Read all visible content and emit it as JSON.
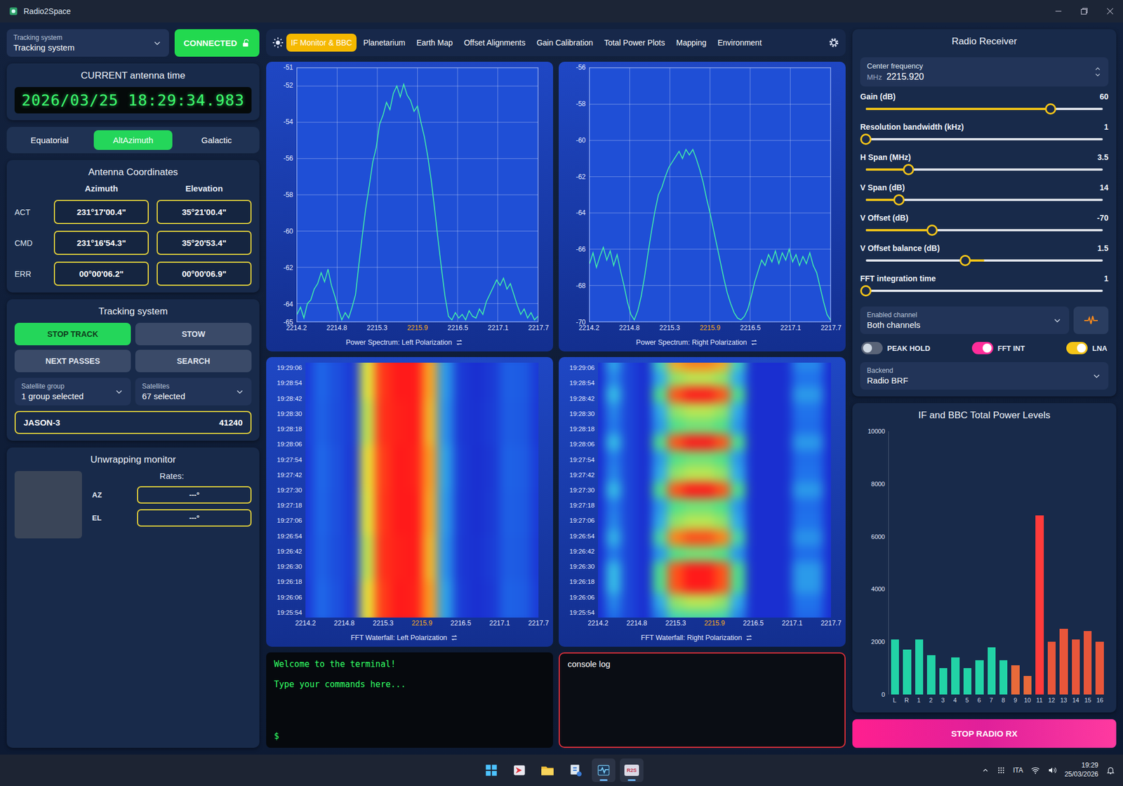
{
  "window": {
    "title": "Radio2Space"
  },
  "left": {
    "tracking_select": {
      "label": "Tracking system",
      "value": "Tracking system"
    },
    "connected": {
      "label": "CONNECTED",
      "on": true
    },
    "time": {
      "title": "CURRENT antenna time",
      "value": "2026/03/25 18:29:34.983"
    },
    "frames": [
      {
        "label": "Equatorial",
        "selected": false
      },
      {
        "label": "AltAzimuth",
        "selected": true
      },
      {
        "label": "Galactic",
        "selected": false
      }
    ],
    "coords": {
      "title": "Antenna Coordinates",
      "columns": [
        "Azimuth",
        "Elevation"
      ],
      "rows": [
        {
          "label": "ACT",
          "values": [
            "231°17'00.4\"",
            "35°21'00.4\""
          ]
        },
        {
          "label": "CMD",
          "values": [
            "231°16'54.3\"",
            "35°20'53.4\""
          ]
        },
        {
          "label": "ERR",
          "values": [
            "00°00'06.2\"",
            "00°00'06.9\""
          ]
        }
      ]
    },
    "tracking": {
      "title": "Tracking system",
      "buttons": [
        {
          "label": "STOP TRACK",
          "active": true
        },
        {
          "label": "STOW",
          "active": false
        },
        {
          "label": "NEXT PASSES",
          "active": false
        },
        {
          "label": "SEARCH",
          "active": false
        }
      ],
      "selects": [
        {
          "label": "Satellite group",
          "value": "1 group selected"
        },
        {
          "label": "Satellites",
          "value": "67 selected"
        }
      ],
      "satellite": {
        "name": "JASON-3",
        "id": "41240"
      }
    },
    "unwrap": {
      "title": "Unwrapping monitor",
      "rates_label": "Rates:",
      "rates": [
        {
          "axis": "AZ",
          "value": "---°"
        },
        {
          "axis": "EL",
          "value": "---°"
        }
      ]
    }
  },
  "tabs": [
    {
      "label": "IF Monitor & BBC",
      "selected": true
    },
    {
      "label": "Planetarium",
      "selected": false
    },
    {
      "label": "Earth Map",
      "selected": false
    },
    {
      "label": "Offset Alignments",
      "selected": false
    },
    {
      "label": "Gain Calibration",
      "selected": false
    },
    {
      "label": "Total Power Plots",
      "selected": false
    },
    {
      "label": "Mapping",
      "selected": false
    },
    {
      "label": "Environment",
      "selected": false
    }
  ],
  "spectra": [
    {
      "title": "Power Spectrum: Left Polarization",
      "y_ticks": [
        "-51",
        "-52",
        "-54",
        "-56",
        "-58",
        "-60",
        "-62",
        "-64",
        "-65"
      ],
      "x_ticks": [
        {
          "label": "2214.2",
          "center": false
        },
        {
          "label": "2214.8",
          "center": false
        },
        {
          "label": "2215.3",
          "center": false
        },
        {
          "label": "2215.9",
          "center": true
        },
        {
          "label": "2216.5",
          "center": false
        },
        {
          "label": "2217.1",
          "center": false
        },
        {
          "label": "2217.7",
          "center": false
        }
      ],
      "values": [
        -64.6,
        -64.2,
        -64.8,
        -64.0,
        -63.8,
        -63.2,
        -62.9,
        -62.3,
        -62.8,
        -62.1,
        -63.0,
        -63.6,
        -64.3,
        -64.9,
        -64.5,
        -64.8,
        -64.2,
        -63.5,
        -61.8,
        -60.2,
        -58.7,
        -57.5,
        -56.2,
        -55.4,
        -54.1,
        -53.6,
        -52.9,
        -53.3,
        -52.4,
        -52.0,
        -52.6,
        -51.9,
        -52.5,
        -52.8,
        -53.4,
        -53.1,
        -54.0,
        -54.8,
        -55.9,
        -57.2,
        -58.8,
        -60.5,
        -62.1,
        -63.6,
        -64.7,
        -64.9,
        -64.5,
        -64.8,
        -64.6,
        -64.9,
        -64.4,
        -64.7,
        -64.8,
        -64.3,
        -64.6,
        -63.9,
        -63.5,
        -63.1,
        -62.7,
        -63.0,
        -62.6,
        -63.2,
        -62.9,
        -63.5,
        -64.1,
        -64.6,
        -64.3,
        -64.8,
        -64.5,
        -64.9,
        -64.7
      ]
    },
    {
      "title": "Power Spectrum: Right Polarization",
      "y_ticks": [
        "-56",
        "-58",
        "-60",
        "-62",
        "-64",
        "-66",
        "-68",
        "-70"
      ],
      "x_ticks": [
        {
          "label": "2214.2",
          "center": false
        },
        {
          "label": "2214.8",
          "center": false
        },
        {
          "label": "2215.3",
          "center": false
        },
        {
          "label": "2215.9",
          "center": true
        },
        {
          "label": "2216.5",
          "center": false
        },
        {
          "label": "2217.1",
          "center": false
        },
        {
          "label": "2217.7",
          "center": false
        }
      ],
      "values": [
        -66.8,
        -66.2,
        -67.0,
        -66.4,
        -65.9,
        -66.6,
        -66.1,
        -66.9,
        -66.3,
        -67.2,
        -68.0,
        -68.9,
        -69.6,
        -69.9,
        -69.4,
        -68.6,
        -67.5,
        -66.2,
        -65.0,
        -63.9,
        -63.0,
        -62.6,
        -62.0,
        -61.5,
        -61.2,
        -60.9,
        -60.6,
        -61.0,
        -60.5,
        -60.8,
        -60.5,
        -61.0,
        -61.6,
        -62.3,
        -63.2,
        -64.0,
        -64.9,
        -65.8,
        -66.7,
        -67.6,
        -68.4,
        -69.0,
        -69.5,
        -69.8,
        -69.9,
        -69.7,
        -69.3,
        -68.6,
        -67.8,
        -67.2,
        -66.6,
        -66.9,
        -66.3,
        -66.7,
        -66.1,
        -66.8,
        -66.2,
        -66.6,
        -66.0,
        -66.7,
        -66.3,
        -66.9,
        -66.4,
        -66.8,
        -66.2,
        -66.9,
        -67.3,
        -68.1,
        -68.9,
        -69.6,
        -69.9
      ]
    }
  ],
  "waterfalls": [
    {
      "title": "FFT Waterfall: Left Polarization",
      "time_ticks": [
        "19:29:06",
        "19:28:54",
        "19:28:42",
        "19:28:30",
        "19:28:18",
        "19:28:06",
        "19:27:54",
        "19:27:42",
        "19:27:30",
        "19:27:18",
        "19:27:06",
        "19:26:54",
        "19:26:42",
        "19:26:30",
        "19:26:18",
        "19:26:06",
        "19:25:54"
      ],
      "x_ticks": [
        {
          "label": "2214.2",
          "center": false
        },
        {
          "label": "2214.8",
          "center": false
        },
        {
          "label": "2215.3",
          "center": false
        },
        {
          "label": "2215.9",
          "center": true
        },
        {
          "label": "2216.5",
          "center": false
        },
        {
          "label": "2217.1",
          "center": false
        },
        {
          "label": "2217.7",
          "center": false
        }
      ],
      "rows": [
        [
          -64.5,
          -62.5,
          -63.5,
          -64.5,
          -56,
          -52.5,
          -52,
          -52,
          -54.5,
          -61,
          -64.5,
          -65,
          -64.5,
          -62.8,
          -63,
          -64.5
        ],
        [
          -64.3,
          -62.7,
          -63.6,
          -64.4,
          -56.4,
          -52.4,
          -52.1,
          -52,
          -54.8,
          -61.2,
          -64.6,
          -64.9,
          -64.4,
          -62.9,
          -63.1,
          -64.6
        ],
        [
          -64.6,
          -62.4,
          -63.4,
          -64.6,
          -55.8,
          -52.6,
          -52,
          -52.1,
          -54.3,
          -60.8,
          -64.4,
          -65,
          -64.6,
          -62.7,
          -62.9,
          -64.4
        ],
        [
          -64.5,
          -62.5,
          -63.5,
          -64.5,
          -56,
          -52.5,
          -52,
          -52,
          -54.5,
          -61,
          -64.5,
          -65,
          -64.5,
          -62.8,
          -63,
          -64.5
        ],
        [
          -64.3,
          -62.7,
          -63.6,
          -64.4,
          -56.4,
          -52.4,
          -52.1,
          -52,
          -54.8,
          -61.2,
          -64.6,
          -64.9,
          -64.4,
          -62.9,
          -63.1,
          -64.6
        ],
        [
          -64.6,
          -62.4,
          -63.4,
          -64.6,
          -55.8,
          -52.6,
          -52,
          -52.1,
          -54.3,
          -60.8,
          -64.4,
          -65,
          -64.6,
          -62.7,
          -62.9,
          -64.4
        ]
      ]
    },
    {
      "title": "FFT Waterfall: Right Polarization",
      "time_ticks": [
        "19:29:06",
        "19:28:54",
        "19:28:42",
        "19:28:30",
        "19:28:18",
        "19:28:06",
        "19:27:54",
        "19:27:42",
        "19:27:30",
        "19:27:18",
        "19:27:06",
        "19:26:54",
        "19:26:42",
        "19:26:30",
        "19:26:18",
        "19:26:06",
        "19:25:54"
      ],
      "x_ticks": [
        {
          "label": "2214.2",
          "center": false
        },
        {
          "label": "2214.8",
          "center": false
        },
        {
          "label": "2215.3",
          "center": false
        },
        {
          "label": "2215.9",
          "center": true
        },
        {
          "label": "2216.5",
          "center": false
        },
        {
          "label": "2217.1",
          "center": false
        },
        {
          "label": "2217.7",
          "center": false
        }
      ],
      "rows": [
        [
          -69,
          -64.6,
          -68,
          -69,
          -63,
          -58.6,
          -57.8,
          -57.8,
          -58.6,
          -63,
          -69,
          -69,
          -69,
          -65.4,
          -65.4,
          -69
        ],
        [
          -69,
          -65.5,
          -68,
          -69,
          -64.5,
          -61,
          -60.5,
          -60.5,
          -61,
          -64.5,
          -69,
          -69,
          -69,
          -66,
          -66,
          -69
        ],
        [
          -69,
          -64,
          -68,
          -69,
          -62,
          -57,
          -56,
          -56,
          -57,
          -62,
          -69,
          -69,
          -69,
          -65,
          -65,
          -69
        ],
        [
          -69,
          -65.5,
          -68,
          -69,
          -64.5,
          -61,
          -60.5,
          -60.5,
          -61,
          -64.5,
          -69,
          -69,
          -69,
          -66,
          -66,
          -69
        ],
        [
          -69,
          -65.8,
          -68,
          -69,
          -65,
          -61.8,
          -61.4,
          -61.4,
          -61.8,
          -65,
          -69,
          -69,
          -69,
          -66.2,
          -66.2,
          -69
        ],
        [
          -69,
          -64,
          -68,
          -69,
          -62,
          -57,
          -56,
          -56,
          -57,
          -62,
          -69,
          -69,
          -69,
          -65,
          -65,
          -69
        ],
        [
          -69,
          -65.8,
          -68,
          -69,
          -65,
          -61.8,
          -61.4,
          -61.4,
          -61.8,
          -65,
          -69,
          -69,
          -69,
          -66.2,
          -66.2,
          -69
        ],
        [
          -69,
          -65.5,
          -68,
          -69,
          -64.5,
          -61,
          -60.5,
          -60.5,
          -61,
          -64.5,
          -69,
          -69,
          -69,
          -66,
          -66,
          -69
        ],
        [
          -69,
          -64,
          -68,
          -69,
          -62,
          -57,
          -56,
          -56,
          -57,
          -62,
          -69,
          -69,
          -69,
          -65,
          -65,
          -69
        ],
        [
          -69,
          -65.8,
          -68,
          -69,
          -65,
          -61.8,
          -61.4,
          -61.4,
          -61.8,
          -65,
          -69,
          -69,
          -69,
          -66.2,
          -66.2,
          -69
        ],
        [
          -69,
          -65.5,
          -68,
          -69,
          -64.5,
          -61,
          -60.5,
          -60.5,
          -61,
          -64.5,
          -69,
          -69,
          -69,
          -66,
          -66,
          -69
        ],
        [
          -69,
          -64.3,
          -68,
          -69,
          -62.5,
          -57.8,
          -56.9,
          -56.9,
          -57.8,
          -62.5,
          -69,
          -69,
          -69,
          -65.2,
          -65.2,
          -69
        ],
        [
          -69,
          -65.8,
          -68,
          -69,
          -65,
          -61.8,
          -61.4,
          -61.4,
          -61.8,
          -65,
          -69,
          -69,
          -69,
          -66.2,
          -66.2,
          -69
        ],
        [
          -69,
          -64,
          -68,
          -69,
          -62,
          -57,
          -56,
          -56,
          -57,
          -62,
          -69,
          -69,
          -69,
          -65,
          -65,
          -69
        ],
        [
          -69,
          -64,
          -68,
          -69,
          -62,
          -57,
          -56,
          -56,
          -57,
          -62,
          -69,
          -69,
          -69,
          -65,
          -65,
          -69
        ],
        [
          -69,
          -65.5,
          -68,
          -69,
          -64.5,
          -61,
          -60.5,
          -60.5,
          -61,
          -64.5,
          -69,
          -69,
          -69,
          -66,
          -66,
          -69
        ],
        [
          -69,
          -66.1,
          -68,
          -69,
          -65.5,
          -62.6,
          -62.3,
          -62.3,
          -62.6,
          -65.5,
          -69,
          -69,
          -69,
          -66.4,
          -66.4,
          -69
        ]
      ]
    }
  ],
  "terminal": {
    "lines": [
      "Welcome to the terminal!",
      "Type your commands here...",
      "$"
    ]
  },
  "console": {
    "title": "console log"
  },
  "receiver": {
    "title": "Radio Receiver",
    "center_freq": {
      "label": "Center frequency",
      "unit": "MHz",
      "value": "2215.920"
    },
    "sliders": [
      {
        "label": "Gain (dB)",
        "reading": "60",
        "level": 0.78,
        "kind": "range"
      },
      {
        "label": "Resolution bandwidth (kHz)",
        "reading": "1",
        "level": 0,
        "kind": "range"
      },
      {
        "label": "H Span (MHz)",
        "reading": "3.5",
        "level": 0.18,
        "kind": "range"
      },
      {
        "label": "V Span (dB)",
        "reading": "14",
        "level": 0.14,
        "kind": "range"
      },
      {
        "label": "V Offset (dB)",
        "reading": "-70",
        "level": 0.28,
        "kind": "range"
      },
      {
        "label": "V Offset balance (dB)",
        "reading": "1.5",
        "level": 0.42,
        "kind": "balance"
      },
      {
        "label": "FFT integration time",
        "reading": "1",
        "level": 0,
        "kind": "range"
      }
    ],
    "channel": {
      "label": "Enabled channel",
      "value": "Both channels"
    },
    "toggles": [
      {
        "label": "PEAK HOLD",
        "on": false,
        "color": "#cfd8e3"
      },
      {
        "label": "FFT INT",
        "on": true,
        "color": "#ff2d9a"
      },
      {
        "label": "LNA",
        "on": true,
        "color": "#f5c518"
      }
    ],
    "backend": {
      "label": "Backend",
      "value": "Radio BRF"
    }
  },
  "power": {
    "title": "IF and BBC Total Power Levels",
    "y_ticks": [
      "10000",
      "8000",
      "6000",
      "4000",
      "2000",
      "0"
    ],
    "bars": [
      {
        "label": "L",
        "value": 2100,
        "color": "#22d3a6"
      },
      {
        "label": "R",
        "value": 1700,
        "color": "#22d3a6"
      },
      {
        "label": "1",
        "value": 2100,
        "color": "#22d3a6"
      },
      {
        "label": "2",
        "value": 1500,
        "color": "#22d3a6"
      },
      {
        "label": "3",
        "value": 1000,
        "color": "#22d3a6"
      },
      {
        "label": "4",
        "value": 1400,
        "color": "#22d3a6"
      },
      {
        "label": "5",
        "value": 1000,
        "color": "#22d3a6"
      },
      {
        "label": "6",
        "value": 1300,
        "color": "#22d3a6"
      },
      {
        "label": "7",
        "value": 1800,
        "color": "#22d3a6"
      },
      {
        "label": "8",
        "value": 1300,
        "color": "#22d3a6"
      },
      {
        "label": "9",
        "value": 1100,
        "color": "#e86a3a"
      },
      {
        "label": "10",
        "value": 700,
        "color": "#e86a3a"
      },
      {
        "label": "11",
        "value": 6800,
        "color": "#ff3b3b"
      },
      {
        "label": "12",
        "value": 2000,
        "color": "#e8563a"
      },
      {
        "label": "13",
        "value": 2500,
        "color": "#e8563a"
      },
      {
        "label": "14",
        "value": 2100,
        "color": "#e8563a"
      },
      {
        "label": "15",
        "value": 2400,
        "color": "#e8563a"
      },
      {
        "label": "16",
        "value": 2000,
        "color": "#e8563a"
      }
    ]
  },
  "stop_button": "STOP RADIO RX",
  "taskbar": {
    "apps": [
      {
        "kind": "start",
        "active": false
      },
      {
        "kind": "arrow",
        "active": false
      },
      {
        "kind": "folder",
        "active": false
      },
      {
        "kind": "tool",
        "active": false
      },
      {
        "kind": "pulse",
        "active": true
      },
      {
        "kind": "r2s",
        "active": true,
        "label": "R2S"
      }
    ],
    "lang": "ITA",
    "time": "19:29",
    "date": "25/03/2026"
  }
}
